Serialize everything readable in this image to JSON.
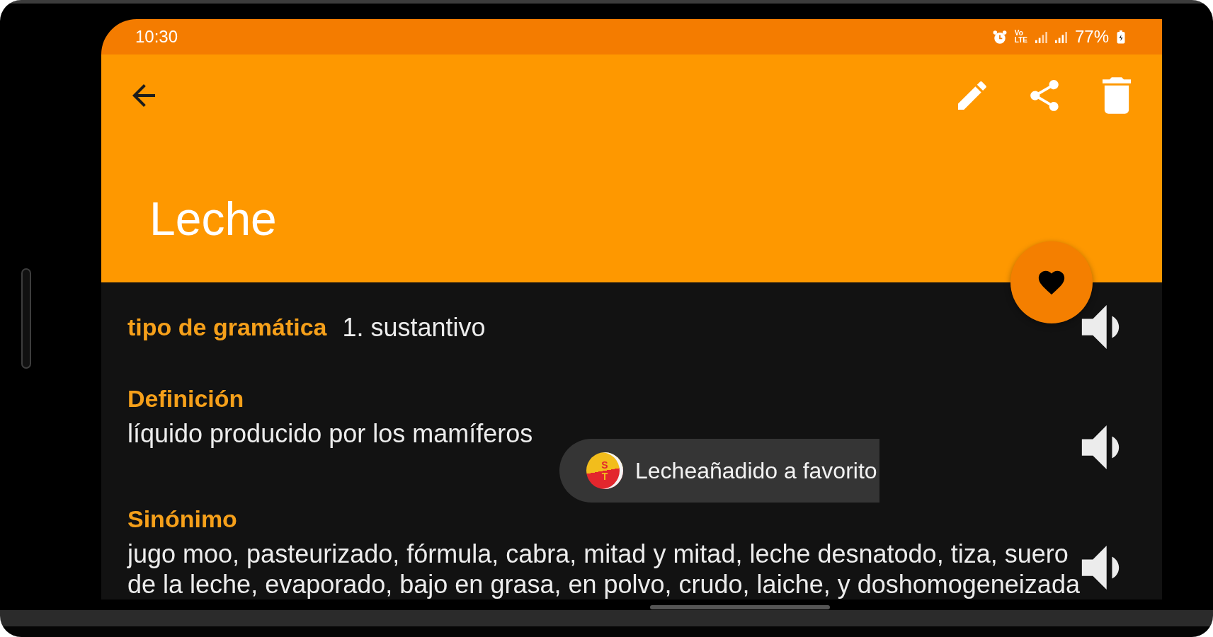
{
  "status_bar": {
    "time": "10:30",
    "network_label": [
      "Vo",
      "LTE"
    ],
    "battery": "77%"
  },
  "app_bar": {
    "title": "Leche"
  },
  "favorite_button": {
    "on": true
  },
  "entries": [
    {
      "kind": "inline",
      "label": "tipo de gramática",
      "value": "1. sustantivo"
    },
    {
      "kind": "block",
      "label": "Definición",
      "value": "líquido producido por los mamíferos"
    },
    {
      "kind": "block",
      "label": "Sinónimo",
      "value": "jugo moo, pasteurizado, fórmula, cabra, mitad y mitad, leche desnatodo, tiza, suero de la leche, evaporado, bajo en grasa, en polvo, crudo, laiche, y doshomogeneizada"
    }
  ],
  "toast": {
    "logo_letters": [
      "S",
      "T"
    ],
    "message": "Lecheañadido a favorito"
  }
}
